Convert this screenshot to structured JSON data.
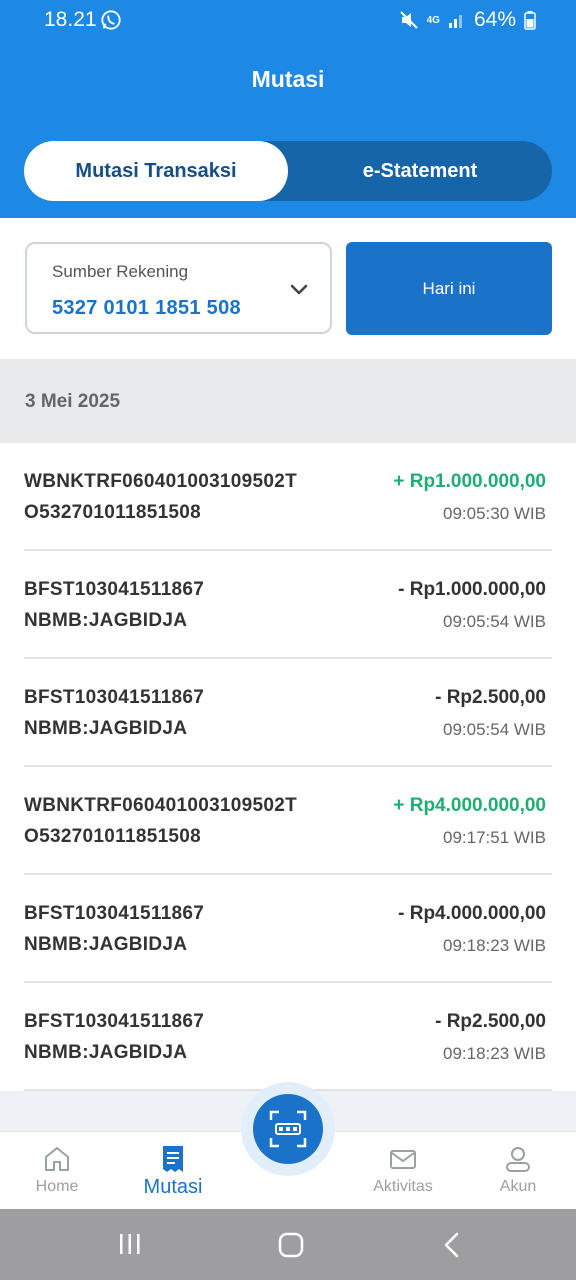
{
  "status_bar": {
    "time": "18.21",
    "network": "4G",
    "battery": "64%",
    "icons": [
      "whatsapp-icon",
      "mute-icon",
      "signal-icon",
      "battery-icon"
    ]
  },
  "header": {
    "title": "Mutasi",
    "tabs": [
      {
        "label": "Mutasi Transaksi",
        "active": true
      },
      {
        "label": "e-Statement",
        "active": false
      }
    ]
  },
  "filter": {
    "account_label": "Sumber Rekening",
    "account_number": "5327 0101 1851 508",
    "period_button": "Hari ini"
  },
  "date_group": "3 Mei 2025",
  "transactions": [
    {
      "line1": "WBNKTRF060401003109502T",
      "line2": "O532701011851508",
      "amount": "+ Rp1.000.000,00",
      "time": "09:05:30 WIB",
      "type": "credit"
    },
    {
      "line1": "BFST103041511867",
      "line2": "NBMB:JAGBIDJA",
      "amount": "- Rp1.000.000,00",
      "time": "09:05:54 WIB",
      "type": "debit"
    },
    {
      "line1": "BFST103041511867",
      "line2": "NBMB:JAGBIDJA",
      "amount": "- Rp2.500,00",
      "time": "09:05:54 WIB",
      "type": "debit"
    },
    {
      "line1": "WBNKTRF060401003109502T",
      "line2": "O532701011851508",
      "amount": "+ Rp4.000.000,00",
      "time": "09:17:51 WIB",
      "type": "credit"
    },
    {
      "line1": "BFST103041511867",
      "line2": "NBMB:JAGBIDJA",
      "amount": "- Rp4.000.000,00",
      "time": "09:18:23 WIB",
      "type": "debit"
    },
    {
      "line1": "BFST103041511867",
      "line2": "NBMB:JAGBIDJA",
      "amount": "- Rp2.500,00",
      "time": "09:18:23 WIB",
      "type": "debit"
    }
  ],
  "bottom_nav": {
    "items": [
      {
        "label": "Home",
        "icon": "home-icon",
        "active": false
      },
      {
        "label": "Mutasi",
        "icon": "receipt-icon",
        "active": true
      },
      {
        "label": "Aktivitas",
        "icon": "mail-icon",
        "active": false
      },
      {
        "label": "Akun",
        "icon": "user-icon",
        "active": false
      }
    ],
    "fab": {
      "label": "QRIS",
      "icon": "qris-scan-icon"
    }
  },
  "system_nav": {
    "icons": [
      "recents-icon",
      "home-circle-icon",
      "back-icon"
    ]
  },
  "colors": {
    "primary": "#1e88e5",
    "primary_dark": "#1565a8",
    "accent_blue": "#1a73c8",
    "credit_green": "#1fae72",
    "text_dark": "#333333"
  }
}
